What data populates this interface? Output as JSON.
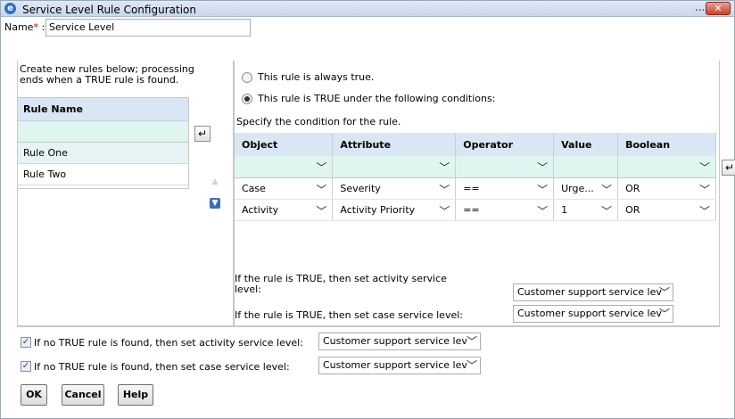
{
  "window": {
    "title": "Service Level Rule Configuration",
    "ellipsis": "...",
    "close": "✕"
  },
  "name_field": {
    "label": "Name",
    "required_mark": "*",
    "colon": " :",
    "value": "Service Level"
  },
  "left": {
    "instructions_line1": "Create new rules below; processing",
    "instructions_line2": "ends when a TRUE rule is found.",
    "rule_header": "Rule Name",
    "rules": [
      {
        "label": "Rule One"
      },
      {
        "label": "Rule Two"
      }
    ]
  },
  "right": {
    "radio_always": "This rule is always true.",
    "radio_conditions": "This rule is TRUE under the following conditions:",
    "specify": "Specify the condition for the rule.",
    "columns": [
      "Object",
      "Attribute",
      "Operator",
      "Value",
      "Boolean"
    ],
    "rows": [
      {
        "object": "Case",
        "attribute": "Severity",
        "operator": "==",
        "value": "Urge...",
        "boolean": "OR"
      },
      {
        "object": "Activity",
        "attribute": "Activity Priority",
        "operator": "==",
        "value": "1",
        "boolean": "OR"
      }
    ],
    "true_activity_label_line1": "If the rule is TRUE, then set activity service",
    "true_activity_label_line2": "level:",
    "true_activity_value": "Customer support service lev",
    "true_case_label": "If the rule is TRUE, then set case service level:",
    "true_case_value": "Customer support service lev"
  },
  "bottom": {
    "no_true_activity_label": "If no TRUE rule is found, then set activity service level:",
    "no_true_activity_value": "Customer support service lev",
    "no_true_case_label": "If no TRUE rule is found, then set case service level:",
    "no_true_case_value": "Customer support service lev",
    "ok": "OK",
    "cancel": "Cancel",
    "help": "Help"
  },
  "icons": {
    "chevron": "﹀",
    "enter": "↵",
    "up": "▲",
    "down": "▼",
    "check": "✓"
  }
}
